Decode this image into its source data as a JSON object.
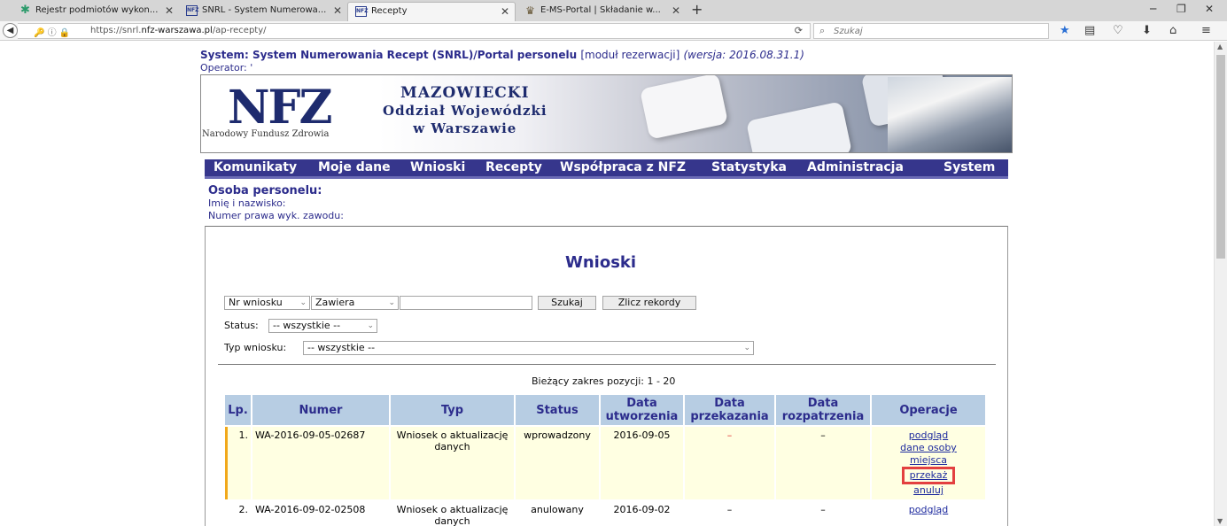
{
  "browser": {
    "tabs": [
      {
        "title": "Rejestr podmiotów wykon...",
        "close": "✕"
      },
      {
        "title": "SNRL - System Numerowa...",
        "close": "✕"
      },
      {
        "title": "Recepty",
        "close": "✕"
      },
      {
        "title": "E-MS-Portal | Składanie w...",
        "close": "✕"
      }
    ],
    "new_tab": "+",
    "url_prefix": "https://snrl.",
    "url_domain": "nfz-warszawa.pl",
    "url_path": "/ap-recepty/",
    "search_placeholder": "Szukaj"
  },
  "header": {
    "system_line": "System: System Numerowania Recept (SNRL)/Portal personelu",
    "module": "[moduł rezerwacji]",
    "version": "(wersja: 2016.08.31.1)",
    "operator": "Operator: '"
  },
  "banner": {
    "logo": "NFZ",
    "logo_sub": "Narodowy Fundusz Zdrowia",
    "line1": "MAZOWIECKI",
    "line2": "Oddział Wojewódzki",
    "line3": "w Warszawie"
  },
  "menu": [
    "Komunikaty",
    "Moje dane",
    "Wnioski",
    "Recepty",
    "Współpraca z NFZ",
    "Statystyka",
    "Administracja",
    "System"
  ],
  "person": {
    "title": "Osoba personelu:",
    "name_label": "Imię i nazwisko:",
    "license_label": "Numer prawa wyk. zawodu:"
  },
  "page_title": "Wnioski",
  "search": {
    "field_select": "Nr wniosku",
    "mode_select": "Zawiera",
    "value": "",
    "search_button": "Szukaj",
    "count_button": "Zlicz rekordy",
    "status_label": "Status:",
    "status_value": "-- wszystkie --",
    "type_label": "Typ wniosku:",
    "type_value": "-- wszystkie --"
  },
  "range": "Bieżący zakres pozycji: 1 - 20",
  "table": {
    "headers": {
      "lp": "Lp.",
      "numer": "Numer",
      "typ": "Typ",
      "status": "Status",
      "utw": "Data utworzenia",
      "przek": "Data przekazania",
      "rozp": "Data rozpatrzenia",
      "oper": "Operacje"
    },
    "rows": [
      {
        "lp": "1.",
        "numer": "WA-2016-09-05-02687",
        "typ": "Wniosek o aktualizację danych",
        "status": "wprowadzony",
        "utw": "2016-09-05",
        "przek": "–",
        "rozp": "–",
        "ops": [
          "podgląd",
          "dane osoby",
          "miejsca",
          "przekaż",
          "anuluj"
        ]
      },
      {
        "lp": "2.",
        "numer": "WA-2016-09-02-02508",
        "typ": "Wniosek o aktualizację danych",
        "status": "anulowany",
        "utw": "2016-09-02",
        "przek": "–",
        "rozp": "–",
        "ops": [
          "podgląd"
        ]
      }
    ]
  },
  "colors": {
    "brand": "#2c2c8c",
    "menu_bg": "#36368c",
    "header_cell": "#b7cde3",
    "row_highlight": "#ffffe2",
    "focus_marker": "#f1a81a",
    "annotation": "#e34040"
  }
}
